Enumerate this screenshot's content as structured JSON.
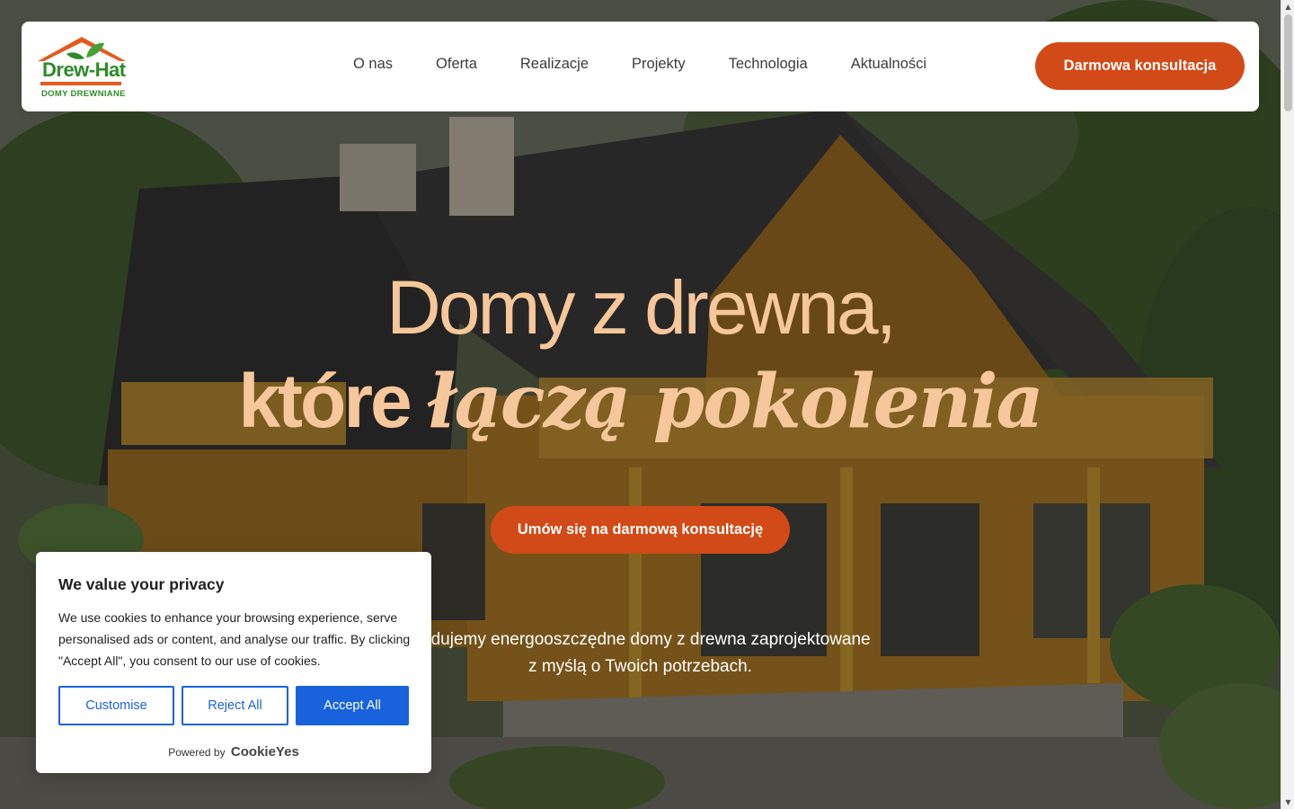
{
  "brand": {
    "name": "Drew-Hat",
    "tagline": "DOMY DREWNIANE",
    "colors": {
      "green": "#2e8b2a",
      "orange": "#d24a17",
      "accent_text": "#f6c79a"
    }
  },
  "nav": {
    "items": [
      {
        "label": "O nas"
      },
      {
        "label": "Oferta"
      },
      {
        "label": "Realizacje"
      },
      {
        "label": "Projekty"
      },
      {
        "label": "Technologia"
      },
      {
        "label": "Aktualności"
      }
    ],
    "cta_label": "Darmowa konsultacja"
  },
  "hero": {
    "headline_line1": "Domy z drewna,",
    "headline_line2_plain": "które",
    "headline_line2_script": "łączą pokolenia",
    "cta_label": "Umów się na darmową konsultację",
    "subtext_line1": "Budujemy energooszczędne domy z drewna zaprojektowane",
    "subtext_line2": "z myślą o Twoich potrzebach."
  },
  "cookie_banner": {
    "title": "We value your privacy",
    "body": "We use cookies to enhance your browsing experience, serve personalised ads or content, and analyse our traffic. By clicking \"Accept All\", you consent to our use of cookies.",
    "buttons": {
      "customise": "Customise",
      "reject": "Reject All",
      "accept": "Accept All"
    },
    "powered_by": "Powered by",
    "powered_brand": "CookieYes",
    "colors": {
      "primary": "#1863dc"
    }
  },
  "icons": {
    "logo": "house-roof-leaf-logo",
    "scroll_up": "triangle-up-icon",
    "scroll_down": "triangle-down-icon"
  }
}
